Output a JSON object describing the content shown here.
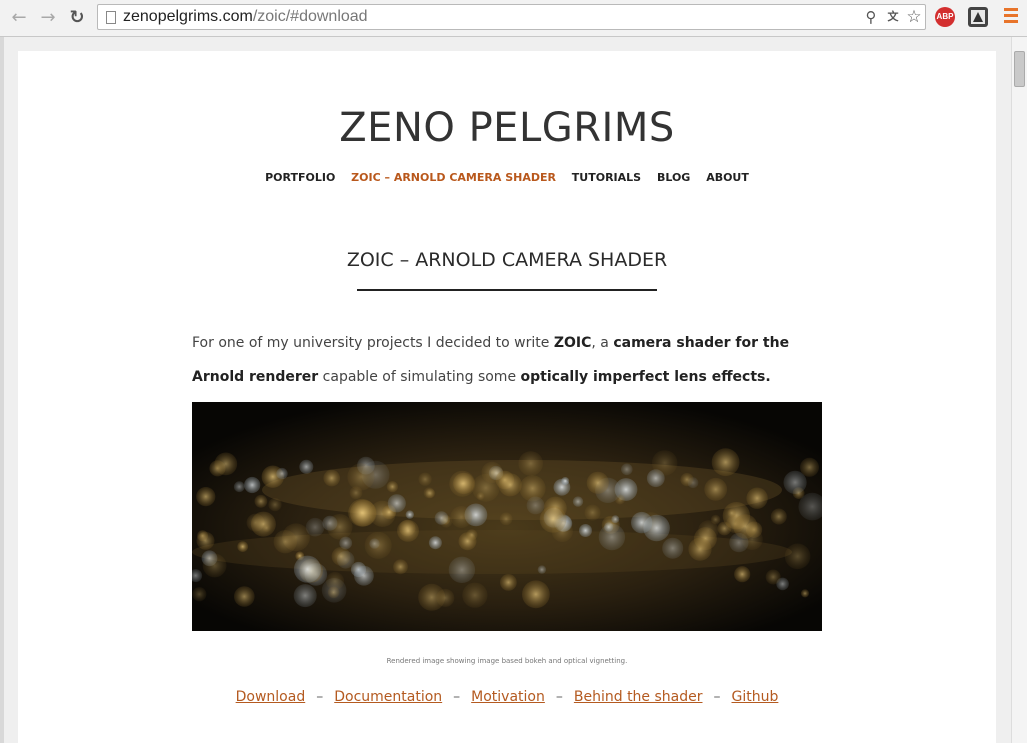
{
  "browser": {
    "url_domain": "zenopelgrims.com",
    "url_path": "/zoic/#download",
    "icons": {
      "back": "back-arrow-icon",
      "forward": "forward-arrow-icon",
      "reload": "reload-icon",
      "page": "page-icon",
      "zoom": "zoom-icon",
      "translate": "translate-icon",
      "bookmark": "star-icon",
      "menu": "menu-icon"
    },
    "extensions": [
      {
        "label": "ABP",
        "color": "#d32f2f"
      },
      {
        "label": "",
        "color": "#444444"
      }
    ]
  },
  "site": {
    "title": "ZENO PELGRIMS",
    "menu": [
      {
        "label": "PORTFOLIO"
      },
      {
        "label": "ZOIC – ARNOLD CAMERA SHADER"
      },
      {
        "label": "TUTORIALS"
      },
      {
        "label": "BLOG"
      },
      {
        "label": "ABOUT"
      }
    ],
    "accent_color": "#b9581c"
  },
  "page": {
    "title": "ZOIC – ARNOLD CAMERA SHADER",
    "intro": {
      "part1": "For one of my university projects I decided to write ",
      "bold1": "ZOIC",
      "part2": ", a ",
      "bold2": "camera shader for the Arnold renderer",
      "part3": " capable of simulating some ",
      "bold3": "optically imperfect lens effects."
    },
    "caption": "Rendered image showing image based bokeh and optical vignetting.",
    "links": [
      {
        "label": "Download"
      },
      {
        "label": "Documentation"
      },
      {
        "label": "Motivation"
      },
      {
        "label": "Behind the shader"
      },
      {
        "label": "Github"
      }
    ],
    "link_separator": "–"
  }
}
